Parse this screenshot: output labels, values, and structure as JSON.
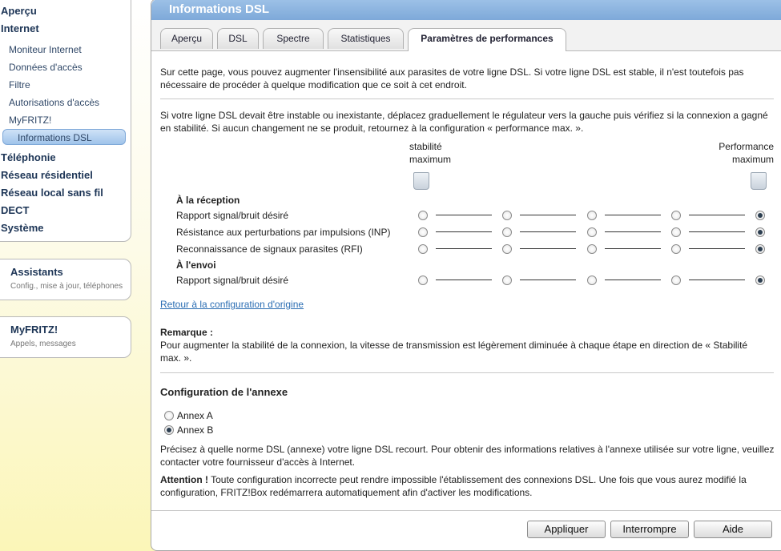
{
  "sidebar": {
    "main_top": [
      {
        "label": "Aperçu"
      },
      {
        "label": "Internet"
      }
    ],
    "internet_sub": [
      {
        "label": "Moniteur Internet"
      },
      {
        "label": "Données d'accès"
      },
      {
        "label": "Filtre"
      },
      {
        "label": "Autorisations d'accès"
      },
      {
        "label": "MyFRITZ!"
      },
      {
        "label": "Informations DSL"
      }
    ],
    "main_bottom": [
      {
        "label": "Téléphonie"
      },
      {
        "label": "Réseau résidentiel"
      },
      {
        "label": "Réseau local sans fil"
      },
      {
        "label": "DECT"
      },
      {
        "label": "Système"
      }
    ],
    "assistants": {
      "title": "Assistants",
      "subtitle": "Config., mise à jour, téléphones"
    },
    "myfritz": {
      "title": "MyFRITZ!",
      "subtitle": "Appels, messages"
    }
  },
  "panel": {
    "title": "Informations DSL",
    "tabs": [
      {
        "label": "Aperçu"
      },
      {
        "label": "DSL"
      },
      {
        "label": "Spectre"
      },
      {
        "label": "Statistiques"
      },
      {
        "label": "Paramètres de performances"
      }
    ],
    "intro1": "Sur cette page, vous pouvez augmenter l'insensibilité aux parasites de votre ligne DSL. Si votre ligne DSL est stable, il n'est toutefois pas nécessaire de procéder à quelque modification que ce soit à cet endroit.",
    "intro2": "Si votre ligne DSL devait être instable ou inexistante, déplacez graduellement le régulateur vers la gauche puis vérifiez si la connexion a gagné en stabilité. Si aucun changement ne se produit, retournez à la configuration « performance max. ».",
    "slider_left_l1": "stabilité",
    "slider_left_l2": "maximum",
    "slider_right_l1": "Performance",
    "slider_right_l2": "maximum",
    "reception_title": "À la réception",
    "reception_rows": [
      {
        "label": "Rapport signal/bruit désiré",
        "selected": 4
      },
      {
        "label": "Résistance aux perturbations par impulsions (INP)",
        "selected": 4
      },
      {
        "label": "Reconnaissance de signaux parasites (RFI)",
        "selected": 4
      }
    ],
    "send_title": "À l'envoi",
    "send_rows": [
      {
        "label": "Rapport signal/bruit désiré",
        "selected": 4
      }
    ],
    "reset_link": "Retour à la configuration d'origine",
    "remark_title": "Remarque :",
    "remark_text": "Pour augmenter la stabilité de la connexion, la vitesse de transmission est légèrement diminuée à chaque étape en direction de « Stabilité max. ».",
    "annex_title": "Configuration de l'annexe",
    "annex_options": [
      {
        "label": "Annex A",
        "selected": false
      },
      {
        "label": "Annex B",
        "selected": true
      }
    ],
    "annex_text": "Précisez à quelle norme DSL (annexe) votre ligne DSL recourt. Pour obtenir des informations relatives à l'annexe utilisée sur votre ligne, veuillez contacter votre fournisseur d'accès à Internet.",
    "attention_label": "Attention !",
    "attention_text": " Toute configuration incorrecte peut rendre impossible l'établissement des connexions DSL. Une fois que vous aurez modifié la configuration, FRITZ!Box redémarrera automatiquement afin d'activer les modifications.",
    "buttons": {
      "apply": "Appliquer",
      "cancel": "Interrompre",
      "help": "Aide"
    }
  }
}
